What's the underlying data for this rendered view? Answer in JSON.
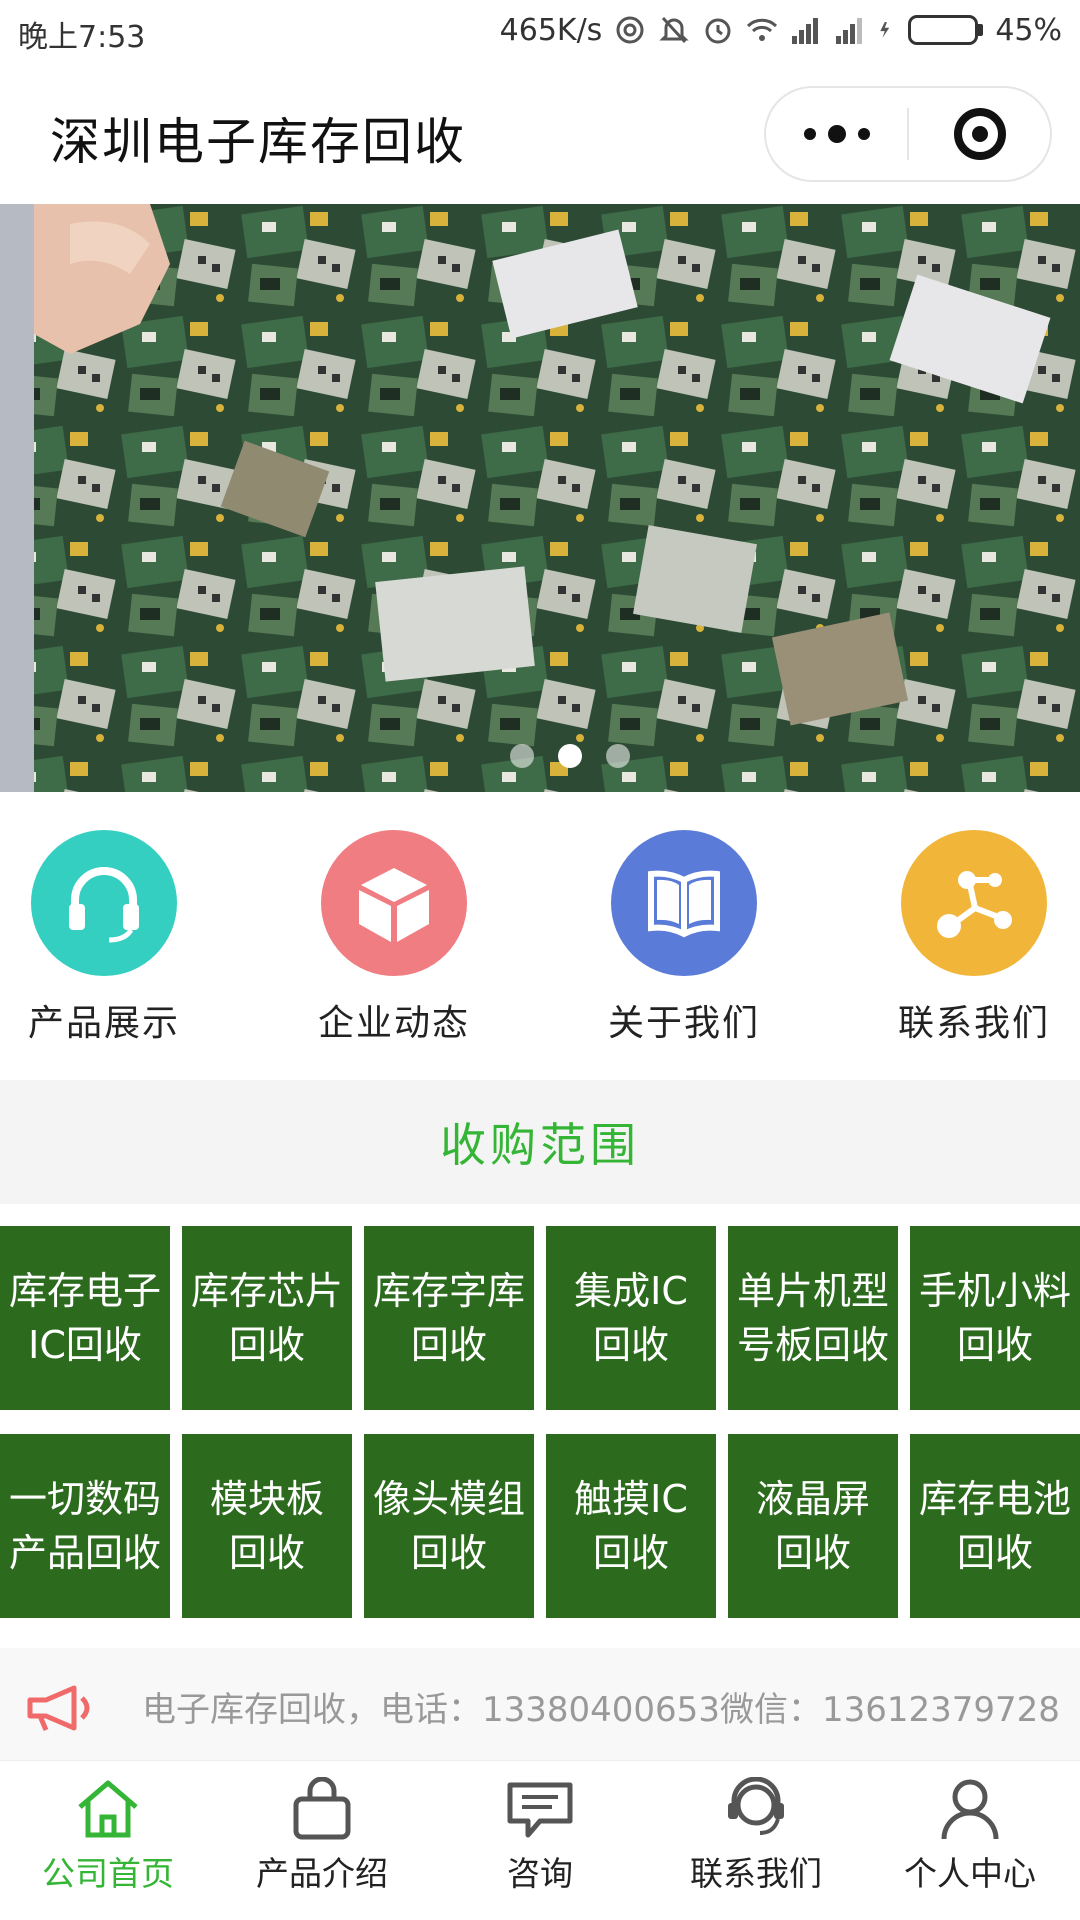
{
  "status_bar": {
    "time": "晚上7:53",
    "speed": "465K/s",
    "battery_percent": "45%",
    "battery_level": 0.45
  },
  "title_bar": {
    "title": "深圳电子库存回收",
    "more_icon": "more-dots-icon",
    "close_icon": "target-icon"
  },
  "banner": {
    "slide_count": 3,
    "active_index": 1
  },
  "nav": [
    {
      "label": "产品展示",
      "icon": "headset-icon",
      "color": "#35cfc1"
    },
    {
      "label": "企业动态",
      "icon": "cube-icon",
      "color": "#f07d82"
    },
    {
      "label": "关于我们",
      "icon": "book-icon",
      "color": "#5b7bd8"
    },
    {
      "label": "联系我们",
      "icon": "share-icon",
      "color": "#f1b53a"
    }
  ],
  "section": {
    "title": "收购范围"
  },
  "categories": [
    [
      "库存电子",
      "IC回收"
    ],
    [
      "库存芯片",
      "回收"
    ],
    [
      "库存字库",
      "回收"
    ],
    [
      "集成IC",
      "回收"
    ],
    [
      "单片机型",
      "号板回收"
    ],
    [
      "手机小料",
      "回收"
    ],
    [
      "一切数码",
      "产品回收"
    ],
    [
      "模块板",
      "回收"
    ],
    [
      "像头模组",
      "回收"
    ],
    [
      "触摸IC",
      "回收"
    ],
    [
      "液晶屏",
      "回收"
    ],
    [
      "库存电池",
      "回收"
    ]
  ],
  "notice": {
    "text": "电子库存回收，电话：13380400653微信：13612379728",
    "icon": "megaphone-icon"
  },
  "tabbar": [
    {
      "label": "公司首页",
      "icon": "home-icon",
      "active": true
    },
    {
      "label": "产品介绍",
      "icon": "bag-icon",
      "active": false
    },
    {
      "label": "咨询",
      "icon": "chat-icon",
      "active": false
    },
    {
      "label": "联系我们",
      "icon": "support-icon",
      "active": false
    },
    {
      "label": "个人中心",
      "icon": "user-icon",
      "active": false
    }
  ],
  "colors": {
    "accent_green": "#35b535",
    "tile_green": "#2c6a1e"
  }
}
